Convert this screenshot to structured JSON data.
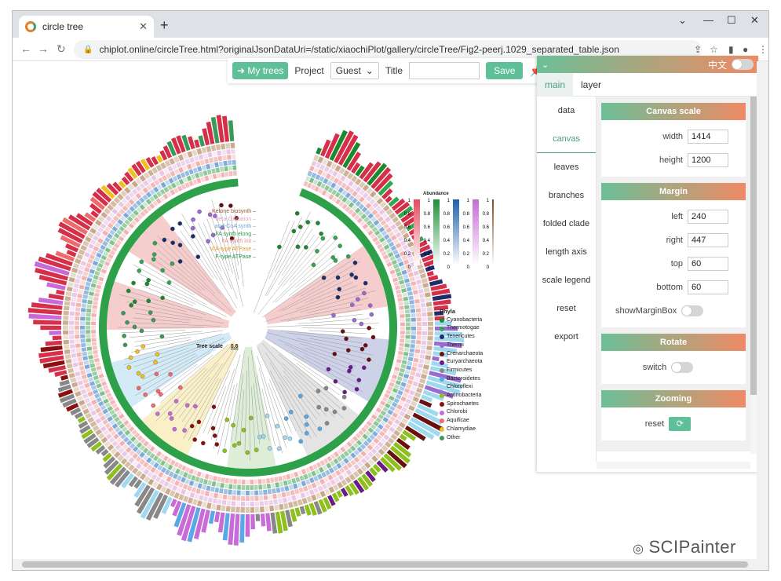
{
  "browser": {
    "tab_title": "circle tree",
    "url": "chiplot.online/circleTree.html?originalJsonDataUri=/static/xiaochiPlot/gallery/circleTree/Fig2-peerj.1029_separated_table.json"
  },
  "toolbar": {
    "my_trees": "My trees",
    "project_label": "Project",
    "project_value": "Guest",
    "title_label": "Title",
    "save": "Save"
  },
  "panel": {
    "lang": "中文",
    "tabs": [
      "main",
      "layer"
    ],
    "menu": [
      "data",
      "canvas",
      "leaves",
      "branches",
      "folded clade",
      "length axis",
      "scale legend",
      "reset",
      "export"
    ],
    "canvas_scale": {
      "title": "Canvas scale",
      "width_label": "width",
      "width": "1414",
      "height_label": "height",
      "height": "1200"
    },
    "margin": {
      "title": "Margin",
      "left_label": "left",
      "left": "240",
      "right_label": "right",
      "right": "447",
      "top_label": "top",
      "top": "60",
      "bottom_label": "bottom",
      "bottom": "60",
      "show_label": "showMarginBox"
    },
    "rotate": {
      "title": "Rotate",
      "switch_label": "switch"
    },
    "zooming": {
      "title": "Zooming",
      "reset_label": "reset"
    }
  },
  "figure": {
    "tree_scale_label": "Tree scale",
    "tree_scale_value": "0.6",
    "abundance_title": "Abundance",
    "abundance_ticks": [
      "1",
      "0.8",
      "0.6",
      "0.4",
      "0.2",
      "0"
    ],
    "features": [
      {
        "label": "Ketone biosynth",
        "color": "#a0522d"
      },
      {
        "label": "beta-Oxidation",
        "color": "#e5a3c5"
      },
      {
        "label": "acyl-CoA synth",
        "color": "#6aa6d6"
      },
      {
        "label": "FA synth elong",
        "color": "#2e9c50"
      },
      {
        "label": "FA synth init",
        "color": "#f08a8a"
      },
      {
        "label": "V/A-type ATPase",
        "color": "#e69b1e"
      },
      {
        "label": "F-type ATPase",
        "color": "#1f8f3a"
      }
    ],
    "phyla_title": "Phyla",
    "phyla": [
      {
        "label": "Cyanobacteria",
        "color": "#1a8a2e"
      },
      {
        "label": "Thermotogae",
        "color": "#2fa84f"
      },
      {
        "label": "Tenericutes",
        "color": "#1c2d6b"
      },
      {
        "label": "Thermi",
        "color": "#9b6ad1"
      },
      {
        "label": "Crenarchaeota",
        "color": "#6b0f0f"
      },
      {
        "label": "Euryarchaeota",
        "color": "#6a1a8a"
      },
      {
        "label": "Firmicutes",
        "color": "#888888"
      },
      {
        "label": "Bacteroidetes",
        "color": "#5aa9e6"
      },
      {
        "label": "Chloroflexi",
        "color": "#9fd9f0"
      },
      {
        "label": "Actinobacteria",
        "color": "#8fbf1f"
      },
      {
        "label": "Spirochaetes",
        "color": "#8a1010"
      },
      {
        "label": "Chlorobi",
        "color": "#c86ad8"
      },
      {
        "label": "Aquificae",
        "color": "#f06a6a"
      },
      {
        "label": "Chlamydiae",
        "color": "#f0c020"
      },
      {
        "label": "Other",
        "color": "#3a9a5a"
      }
    ]
  },
  "watermark": "SCIPainter"
}
